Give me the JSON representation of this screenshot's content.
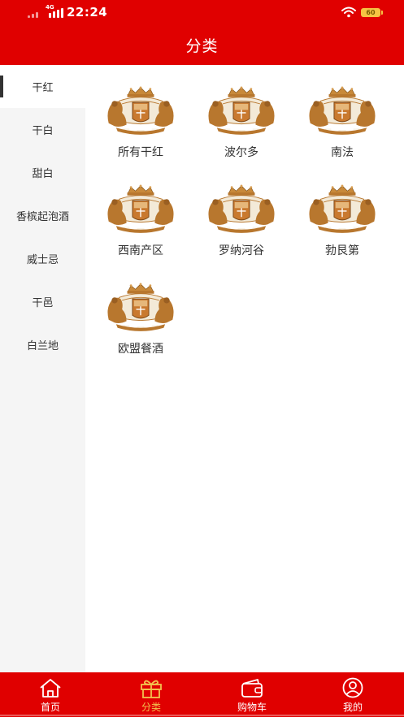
{
  "status_bar": {
    "time": "22:24",
    "network": "4G",
    "battery": "60"
  },
  "header": {
    "title": "分类"
  },
  "sidebar": {
    "items": [
      {
        "label": "干红"
      },
      {
        "label": "干白"
      },
      {
        "label": "甜白"
      },
      {
        "label": "香槟起泡酒"
      },
      {
        "label": "威士忌"
      },
      {
        "label": "干邑"
      },
      {
        "label": "白兰地"
      }
    ]
  },
  "grid": {
    "items": [
      {
        "label": "所有干红",
        "icon": "crest-logo-icon"
      },
      {
        "label": "波尔多",
        "icon": "crest-logo-icon"
      },
      {
        "label": "南法",
        "icon": "crest-logo-icon"
      },
      {
        "label": "西南产区",
        "icon": "crest-logo-icon"
      },
      {
        "label": "罗纳河谷",
        "icon": "crest-logo-icon"
      },
      {
        "label": "勃艮第",
        "icon": "crest-logo-icon"
      },
      {
        "label": "欧盟餐酒",
        "icon": "crest-logo-icon"
      }
    ]
  },
  "tabbar": {
    "tabs": [
      {
        "label": "首页",
        "icon": "home-icon"
      },
      {
        "label": "分类",
        "icon": "gift-icon"
      },
      {
        "label": "购物车",
        "icon": "wallet-icon"
      },
      {
        "label": "我的",
        "icon": "user-icon"
      }
    ]
  },
  "colors": {
    "brand_red": "#e00000",
    "active_tab": "#f2c14e",
    "sidebar_bg": "#f5f5f5",
    "logo_gold": "#b8772e"
  }
}
